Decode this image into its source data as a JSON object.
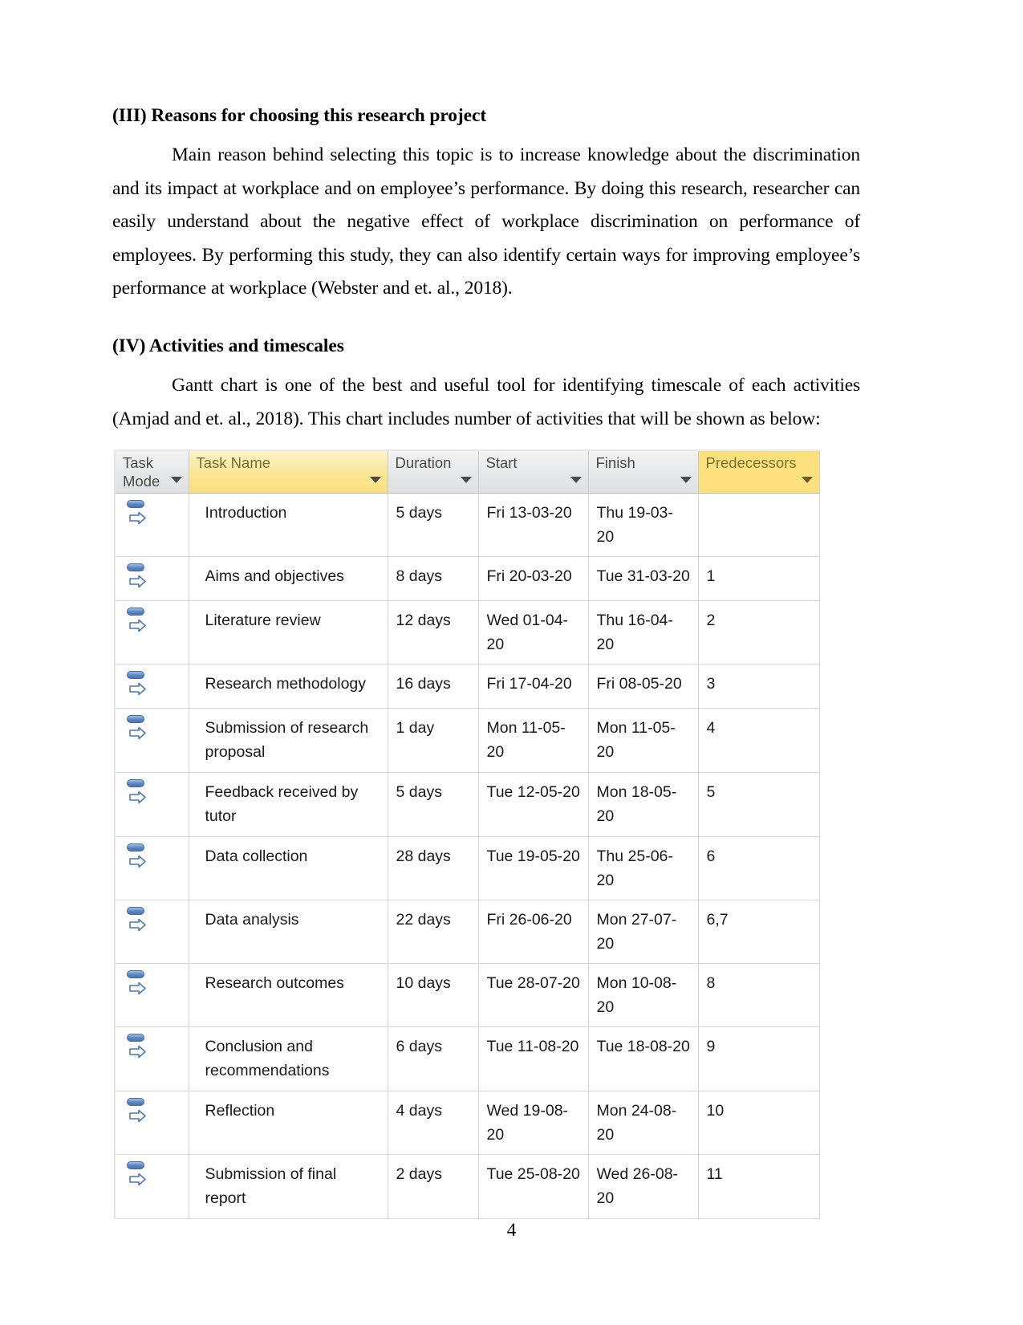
{
  "document": {
    "page_number": "4",
    "sections": [
      {
        "heading": "(III) Reasons for choosing this research project",
        "paragraph": "Main reason behind selecting this topic is to increase knowledge about the discrimination and its impact at workplace and on employee’s performance. By doing this research, researcher can easily understand about the negative effect of workplace discrimination on performance of employees. By performing this study, they can also identify certain ways for improving employee’s performance at workplace (Webster and et. al., 2018)."
      },
      {
        "heading": "(IV) Activities and timescales",
        "paragraph": "Gantt chart is one of the best and useful tool for identifying timescale of each activities (Amjad and et. al., 2018). This chart includes number of activities that will be shown as below:"
      }
    ]
  },
  "chart_data": {
    "type": "table",
    "title": "Gantt chart task list",
    "columns": [
      {
        "key": "task_mode",
        "label": "Task Mode",
        "highlight": "none"
      },
      {
        "key": "task_name",
        "label": "Task Name",
        "highlight": "gradient"
      },
      {
        "key": "duration",
        "label": "Duration",
        "highlight": "none"
      },
      {
        "key": "start",
        "label": "Start",
        "highlight": "none"
      },
      {
        "key": "finish",
        "label": "Finish",
        "highlight": "none"
      },
      {
        "key": "predecessors",
        "label": "Predecessors",
        "highlight": "solid"
      }
    ],
    "rows": [
      {
        "id": 1,
        "task_mode_icon": "auto-schedule-icon",
        "task_name": "Introduction",
        "duration": "5 days",
        "start": "Fri 13-03-20",
        "finish": "Thu 19-03-20",
        "predecessors": "",
        "lines": 1
      },
      {
        "id": 2,
        "task_mode_icon": "auto-schedule-icon",
        "task_name": "Aims and objectives",
        "duration": "8 days",
        "start": "Fri 20-03-20",
        "finish": "Tue 31-03-20",
        "predecessors": "1",
        "lines": 1
      },
      {
        "id": 3,
        "task_mode_icon": "auto-schedule-icon",
        "task_name": "Literature review",
        "duration": "12 days",
        "start": "Wed 01-04-20",
        "finish": "Thu 16-04-20",
        "predecessors": "2",
        "lines": 1
      },
      {
        "id": 4,
        "task_mode_icon": "auto-schedule-icon",
        "task_name": "Research methodology",
        "duration": "16 days",
        "start": "Fri 17-04-20",
        "finish": "Fri 08-05-20",
        "predecessors": "3",
        "lines": 1
      },
      {
        "id": 5,
        "task_mode_icon": "auto-schedule-icon",
        "task_name": "Submission of research proposal",
        "duration": "1 day",
        "start": "Mon 11-05-20",
        "finish": "Mon 11-05-20",
        "predecessors": "4",
        "lines": 2
      },
      {
        "id": 6,
        "task_mode_icon": "auto-schedule-icon",
        "task_name": "Feedback received by tutor",
        "duration": "5 days",
        "start": "Tue 12-05-20",
        "finish": "Mon 18-05-20",
        "predecessors": "5",
        "lines": 2
      },
      {
        "id": 7,
        "task_mode_icon": "auto-schedule-icon",
        "task_name": "Data collection",
        "duration": "28 days",
        "start": "Tue 19-05-20",
        "finish": "Thu 25-06-20",
        "predecessors": "6",
        "lines": 1
      },
      {
        "id": 8,
        "task_mode_icon": "auto-schedule-icon",
        "task_name": "Data analysis",
        "duration": "22 days",
        "start": "Fri 26-06-20",
        "finish": "Mon 27-07-20",
        "predecessors": "6,7",
        "lines": 1
      },
      {
        "id": 9,
        "task_mode_icon": "auto-schedule-icon",
        "task_name": "Research outcomes",
        "duration": "10 days",
        "start": "Tue 28-07-20",
        "finish": "Mon 10-08-20",
        "predecessors": "8",
        "lines": 1
      },
      {
        "id": 10,
        "task_mode_icon": "auto-schedule-icon",
        "task_name": "Conclusion and recommendations",
        "duration": "6 days",
        "start": "Tue 11-08-20",
        "finish": "Tue 18-08-20",
        "predecessors": "9",
        "lines": 2
      },
      {
        "id": 11,
        "task_mode_icon": "auto-schedule-icon",
        "task_name": "Reflection",
        "duration": "4 days",
        "start": "Wed 19-08-20",
        "finish": "Mon 24-08-20",
        "predecessors": "10",
        "lines": 1
      },
      {
        "id": 12,
        "task_mode_icon": "auto-schedule-icon",
        "task_name": "Submission of final report",
        "duration": "2 days",
        "start": "Tue 25-08-20",
        "finish": "Wed 26-08-20",
        "predecessors": "11",
        "lines": 2
      }
    ],
    "colors": {
      "header_gray": "#e2e4e7",
      "header_yellow_gradient_top": "#fcf4c5",
      "header_yellow_gradient_bottom": "#fbdf7f",
      "header_yellow_solid": "#fce07e",
      "grid_line": "#d5d5d5",
      "task_icon_blue": "#5a86c4"
    }
  }
}
